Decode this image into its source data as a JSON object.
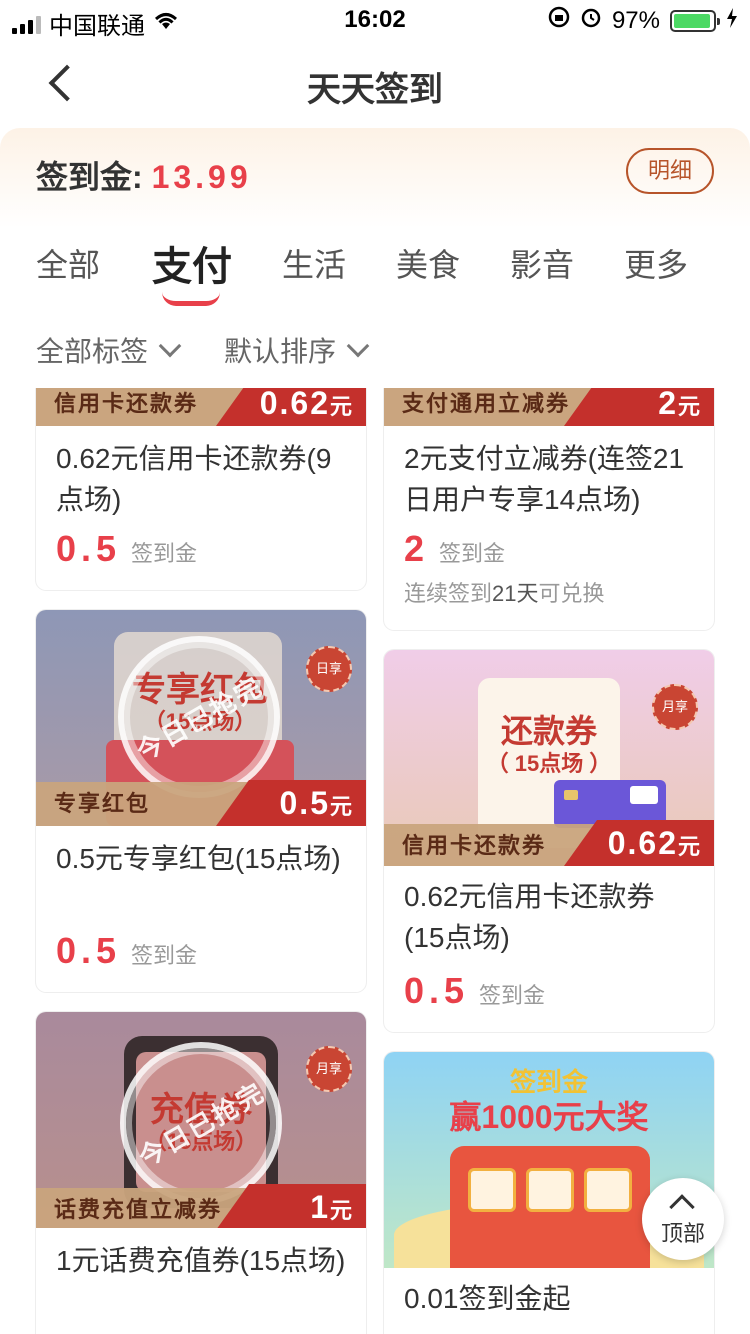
{
  "status": {
    "carrier": "中国联通",
    "time": "16:02",
    "battery": "97%"
  },
  "nav": {
    "title": "天天签到"
  },
  "balance": {
    "label": "签到金:",
    "value": "13.99",
    "detail_btn": "明细"
  },
  "tabs": [
    {
      "label": "全部"
    },
    {
      "label": "支付"
    },
    {
      "label": "生活"
    },
    {
      "label": "美食"
    },
    {
      "label": "影音"
    },
    {
      "label": "更多"
    }
  ],
  "filters": {
    "tag": "全部标签",
    "sort": "默认排序"
  },
  "cards": [
    {
      "ribbon": "信用卡还款券",
      "amount": "0.62",
      "unit": "元",
      "title": "0.62元信用卡还款券(9点场)",
      "price": "0.5",
      "price_unit": "签到金"
    },
    {
      "ribbon": "支付通用立减券",
      "amount": "2",
      "unit": "元",
      "title": "2元支付立减券(连签21日用户专享14点场)",
      "price": "2",
      "price_unit": "签到金",
      "note_pre": "连续签到",
      "note_days": "21天",
      "note_post": "可兑换"
    },
    {
      "ribbon": "专享红包",
      "amount": "0.5",
      "unit": "元",
      "title": "0.5元专享红包(15点场)",
      "price": "0.5",
      "price_unit": "签到金",
      "badge": "日享",
      "art_title": "专享红包",
      "art_sub": "（15点场）",
      "stamp": "今日已抢完"
    },
    {
      "ribbon": "信用卡还款券",
      "amount": "0.62",
      "unit": "元",
      "title": "0.62元信用卡还款券(15点场)",
      "price": "0.5",
      "price_unit": "签到金",
      "badge": "月享",
      "art_title": "还款券",
      "art_sub": "（ 15点场 ）"
    },
    {
      "ribbon": "话费充值立减券",
      "amount": "1",
      "unit": "元",
      "title": "1元话费充值券(15点场)",
      "badge": "月享",
      "art_title": "充值券",
      "art_sub": "（15点场）",
      "stamp": "今日已抢完"
    },
    {
      "title": "0.01签到金起",
      "art_title": "签到金",
      "art_sub": "赢1000元大奖"
    }
  ],
  "top_button": "顶部",
  "colors": {
    "accent": "#e8404a",
    "brand_brown": "#b7542a",
    "ribbon_red": "#c4302c"
  }
}
